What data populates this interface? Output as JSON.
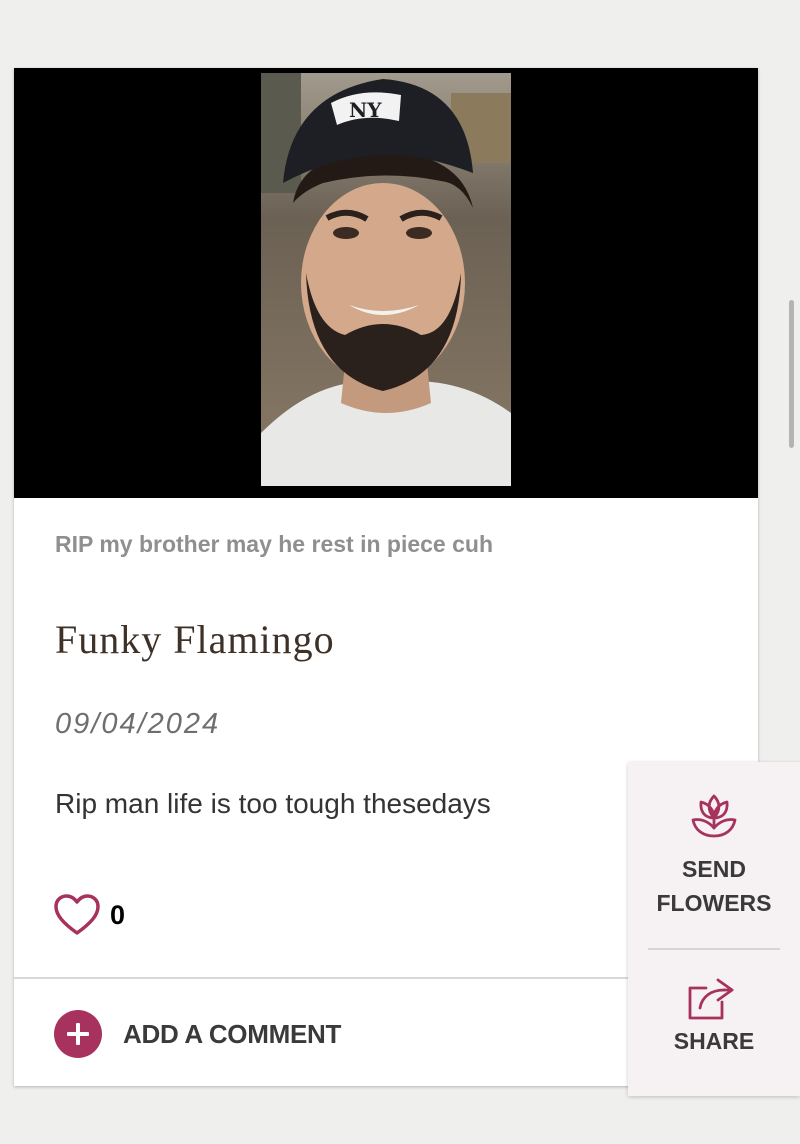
{
  "post": {
    "photo": "portrait-photo",
    "caption": "RIP my brother may he rest in piece cuh",
    "author": "Funky Flamingo",
    "date": "09/04/2024",
    "message": "Rip man life is too tough thesedays",
    "likes": "0"
  },
  "actions": {
    "add_comment": "ADD A COMMENT",
    "send_flowers_line1": "SEND",
    "send_flowers_line2": "FLOWERS",
    "share": "SHARE"
  },
  "colors": {
    "accent": "#a8325e",
    "heading": "#3d3128",
    "panel_bg": "#f6f1f2"
  },
  "icons": [
    "heart-icon",
    "plus-icon",
    "flower-icon",
    "share-icon"
  ]
}
